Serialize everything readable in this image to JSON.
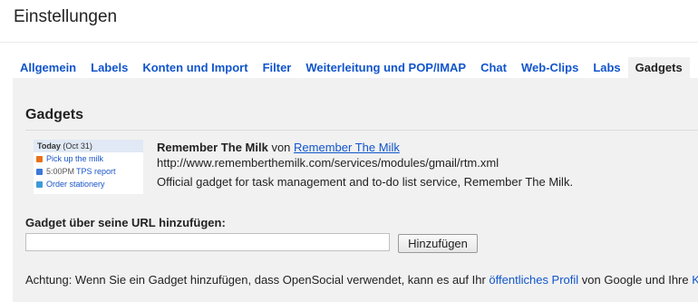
{
  "page": {
    "title": "Einstellungen"
  },
  "tabs": [
    {
      "label": "Allgemein",
      "active": false
    },
    {
      "label": "Labels",
      "active": false
    },
    {
      "label": "Konten und Import",
      "active": false
    },
    {
      "label": "Filter",
      "active": false
    },
    {
      "label": "Weiterleitung und POP/IMAP",
      "active": false
    },
    {
      "label": "Chat",
      "active": false
    },
    {
      "label": "Web-Clips",
      "active": false
    },
    {
      "label": "Labs",
      "active": false
    },
    {
      "label": "Gadgets",
      "active": true
    }
  ],
  "section": {
    "title": "Gadgets"
  },
  "gadget": {
    "name": "Remember The Milk",
    "by": "von",
    "author": "Remember The Milk",
    "url": "http://www.rememberthemilk.com/services/modules/gmail/rtm.xml",
    "description": "Official gadget for task management and to-do list service, Remember The Milk.",
    "thumbnail": {
      "today": "Today",
      "date": "(Oct 31)",
      "items": [
        {
          "time": "",
          "label": "Pick up the milk",
          "color": "#e8711a"
        },
        {
          "time": "5:00PM",
          "label": "TPS report",
          "color": "#3c78d8"
        },
        {
          "time": "",
          "label": "Order stationery",
          "color": "#3c9ad8"
        }
      ]
    }
  },
  "add": {
    "label": "Gadget über seine URL hinzufügen:",
    "input_value": "",
    "button": "Hinzufügen"
  },
  "notice": {
    "text": "Achtung: Wenn Sie ein Gadget hinzufügen, dass OpenSocial verwendet, kann es auf Ihr ",
    "link1": "öffentliches Profil",
    "middle": " von Google und Ihre ",
    "link2": "Ko"
  }
}
